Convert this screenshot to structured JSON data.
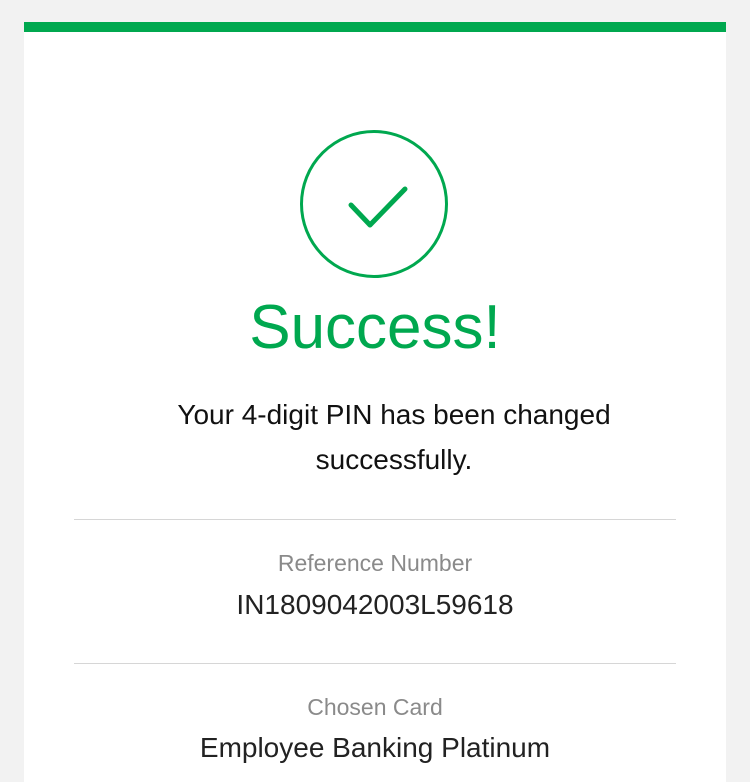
{
  "colors": {
    "accent": "#00a84f",
    "divider": "#d6d6d6",
    "label": "#8a8a8a",
    "text": "#111111"
  },
  "status": {
    "icon": "check-circle-icon",
    "title": "Success!",
    "message": "Your 4-digit PIN has been changed successfully."
  },
  "details": {
    "reference_label": "Reference Number",
    "reference_value": "IN1809042003L59618",
    "card_label": "Chosen Card",
    "card_value": "Employee Banking Platinum"
  }
}
